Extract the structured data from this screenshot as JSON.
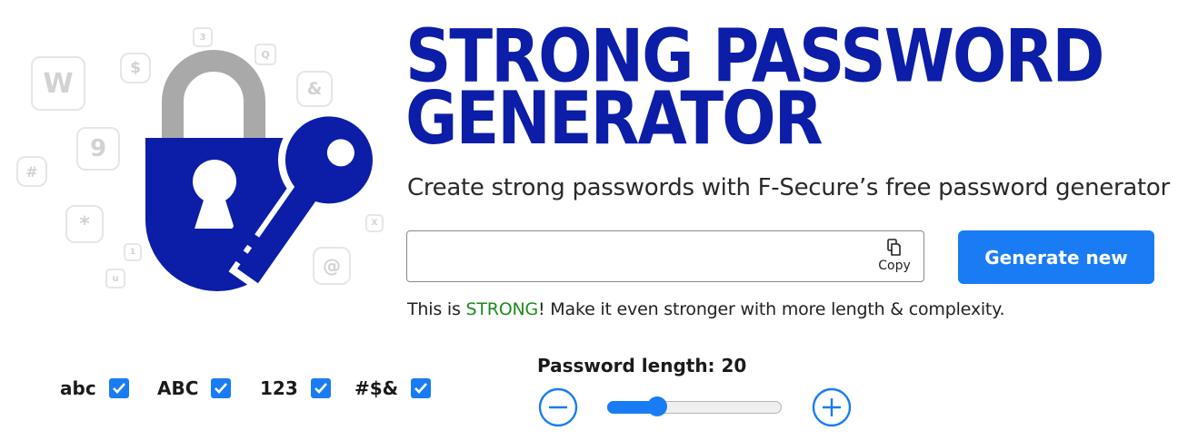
{
  "hero": {
    "tiles": [
      "W",
      "$",
      "3",
      "Q",
      "&",
      "9",
      "#",
      "*",
      "1",
      "u",
      "X",
      "@"
    ],
    "lock_color": "#0c1da8",
    "shackle_color": "#a9a9a9"
  },
  "header": {
    "title_line1": "STRONG PASSWORD",
    "title_line2": "GENERATOR",
    "subtitle": "Create strong passwords with F-Secure’s free password generator"
  },
  "password": {
    "value": "",
    "copy_label": "Copy",
    "generate_label": "Generate new"
  },
  "strength": {
    "prefix": "This is ",
    "level": "STRONG",
    "suffix": "! Make it even stronger with more length & complexity.",
    "level_color": "#1f8a1f"
  },
  "options": [
    {
      "label": "abc",
      "checked": true
    },
    {
      "label": "ABC",
      "checked": true
    },
    {
      "label": "123",
      "checked": true
    },
    {
      "label": "#$&",
      "checked": true
    }
  ],
  "length": {
    "label": "Password length: 20",
    "value": 20,
    "fraction": 0.29
  },
  "colors": {
    "brand_blue": "#0c1da8",
    "accent": "#1a7cf4"
  }
}
